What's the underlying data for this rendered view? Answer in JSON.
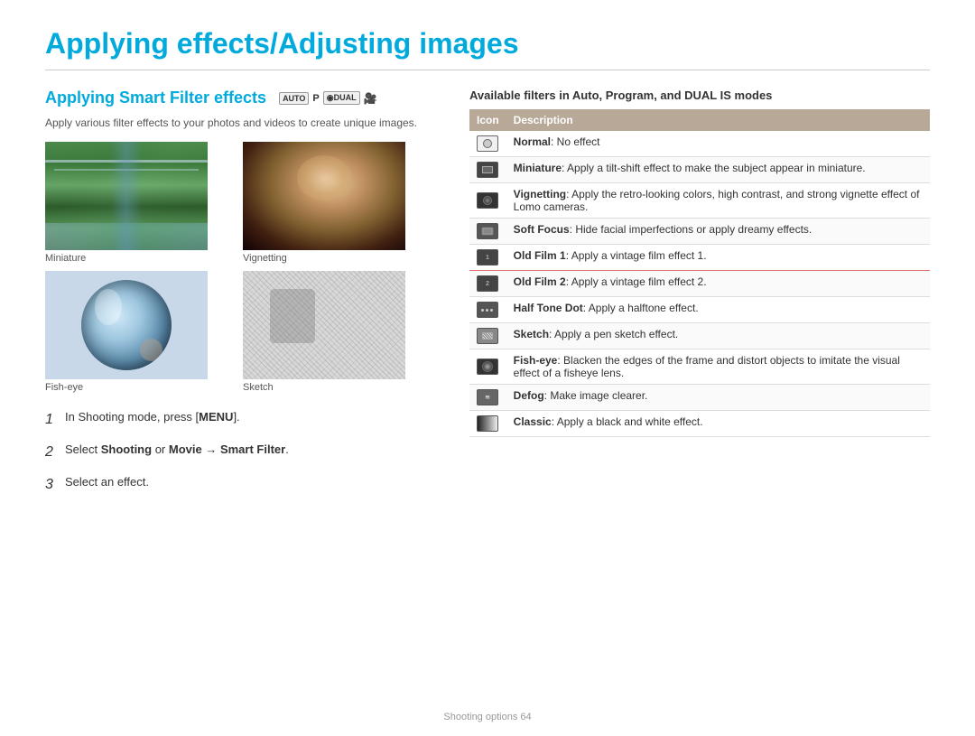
{
  "page": {
    "title": "Applying effects/Adjusting images",
    "footer": "Shooting options  64"
  },
  "left": {
    "section_title": "Applying Smart Filter effects",
    "mode_icons": [
      "AUTO",
      "P",
      "DUAL",
      "🎥"
    ],
    "description": "Apply various filter effects to your photos and videos to create unique images.",
    "photos": [
      {
        "label": "Miniature",
        "type": "miniature"
      },
      {
        "label": "Vignetting",
        "type": "vignetting"
      },
      {
        "label": "Fish-eye",
        "type": "fisheye"
      },
      {
        "label": "Sketch",
        "type": "sketch"
      }
    ],
    "steps": [
      {
        "num": "1",
        "text_before": "In Shooting mode, press [",
        "bold": "MENU",
        "text_after": "]."
      },
      {
        "num": "2",
        "text_before": "Select ",
        "bold1": "Shooting",
        "mid": " or ",
        "bold2": "Movie",
        "arrow": " → ",
        "bold3": "Smart Filter",
        "text_after": "."
      },
      {
        "num": "3",
        "text_plain": "Select an effect."
      }
    ]
  },
  "right": {
    "section_title": "Available filters in Auto, Program, and DUAL IS modes",
    "table_headers": [
      "Icon",
      "Description"
    ],
    "filters": [
      {
        "icon": "normal",
        "bold": "Normal",
        "desc": ": No effect"
      },
      {
        "icon": "miniature",
        "bold": "Miniature",
        "desc": ": Apply a tilt-shift effect to make the subject appear in miniature."
      },
      {
        "icon": "vignetting",
        "bold": "Vignetting",
        "desc": ": Apply the retro-looking colors, high contrast, and strong vignette effect of Lomo cameras."
      },
      {
        "icon": "softfocus",
        "bold": "Soft Focus",
        "desc": ": Hide facial imperfections or apply dreamy effects."
      },
      {
        "icon": "oldfilm1",
        "bold": "Old Film 1",
        "desc": ": Apply a vintage film effect 1.",
        "separator": "red"
      },
      {
        "icon": "oldfilm2",
        "bold": "Old Film 2",
        "desc": ": Apply a vintage film effect 2."
      },
      {
        "icon": "halftone",
        "bold": "Half Tone Dot",
        "desc": ": Apply a halftone effect."
      },
      {
        "icon": "sketch",
        "bold": "Sketch",
        "desc": ": Apply a pen sketch effect."
      },
      {
        "icon": "fisheye",
        "bold": "Fish-eye",
        "desc": ": Blacken the edges of the frame and distort objects to imitate the visual effect of a fisheye lens."
      },
      {
        "icon": "defog",
        "bold": "Defog",
        "desc": ": Make image clearer."
      },
      {
        "icon": "classic",
        "bold": "Classic",
        "desc": ": Apply a black and white effect."
      }
    ]
  }
}
